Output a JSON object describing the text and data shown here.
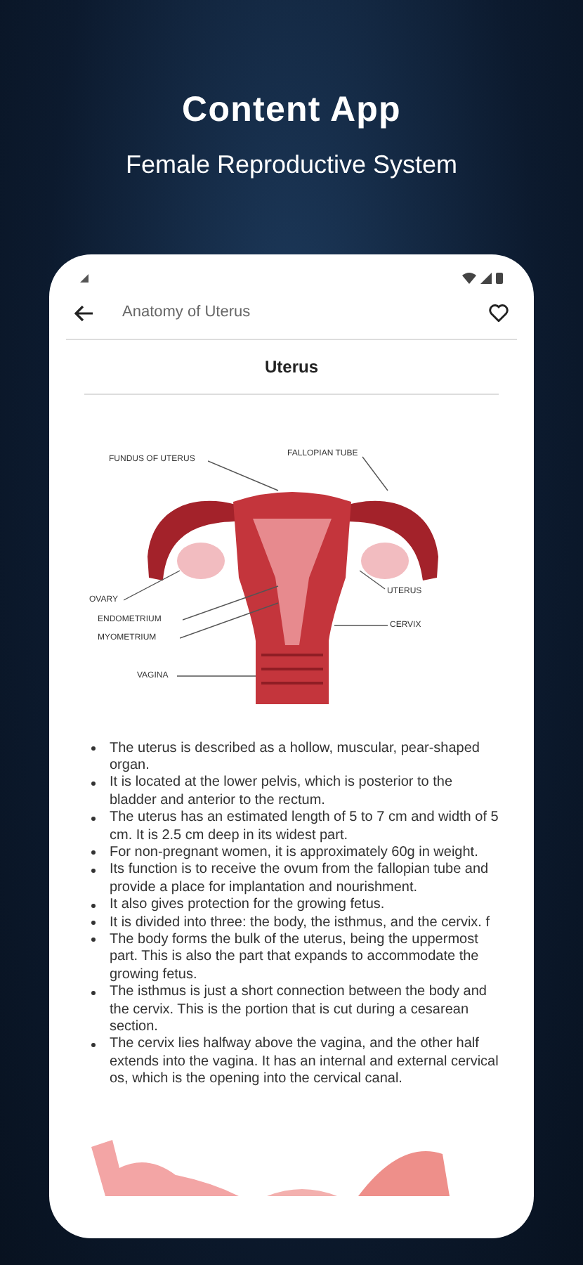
{
  "header": {
    "title": "Content App",
    "subtitle": "Female Reproductive System"
  },
  "app_bar": {
    "title": "Anatomy of Uterus",
    "favorited": false
  },
  "section_title": "Uterus",
  "diagram_labels": [
    {
      "text": "FUNDUS OF UTERUS"
    },
    {
      "text": "FALLOPIAN TUBE"
    },
    {
      "text": "OVARY"
    },
    {
      "text": "ENDOMETRIUM"
    },
    {
      "text": "MYOMETRIUM"
    },
    {
      "text": "VAGINA"
    },
    {
      "text": "UTERUS"
    },
    {
      "text": "CERVIX"
    }
  ],
  "bullets": [
    "The uterus is described as a hollow, muscular, pear-shaped organ.",
    "It is located at the lower pelvis, which is posterior to the bladder and anterior to the rectum.",
    "The uterus has an estimated length of 5 to 7 cm and width of 5 cm. It is 2.5 cm deep in its widest part.",
    "For non-pregnant women, it is approximately 60g in weight.",
    "Its function is to receive the ovum from the fallopian tube and provide a place for implantation and nourishment.",
    "It also gives protection for the growing fetus.",
    "It is divided into three: the body, the isthmus, and the cervix. f",
    "The body forms the bulk of the uterus, being the uppermost part. This is also the part that expands to accommodate the growing fetus.",
    "The isthmus is just a short connection between the body and the cervix. This is the portion that is cut during a cesarean section.",
    "The cervix lies halfway above the vagina, and the other half extends into the vagina. It has an internal and external cervical os, which is the opening into the cervical canal."
  ]
}
